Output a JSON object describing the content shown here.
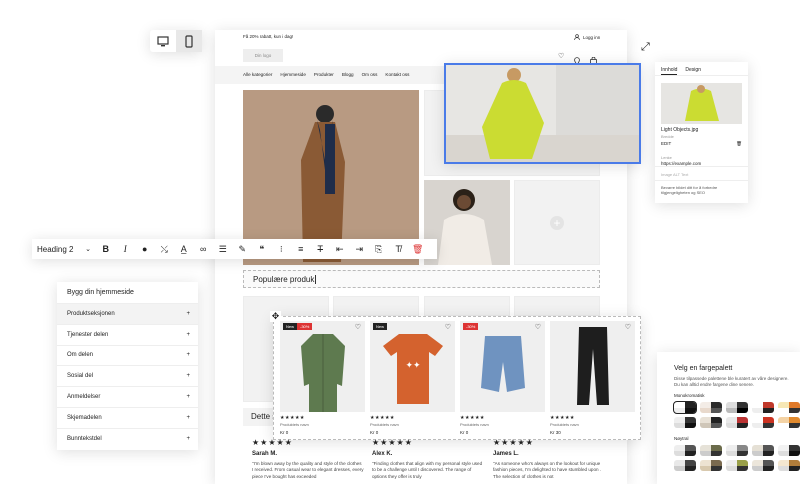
{
  "device_toggle": {
    "desktop": "desktop-icon",
    "mobile": "mobile-icon"
  },
  "site": {
    "promo": "Få 20% rabatt, kun i dag!",
    "login": "Logg inn",
    "logo": "Din logo",
    "nav": [
      "Alle kategorier",
      "Hjemmeside",
      "Produkter",
      "Blogg",
      "Om oss",
      "Kontakt oss"
    ],
    "section_heading": "Populære produk",
    "second_heading": "Dette s"
  },
  "toolbar": {
    "heading_select": "Heading 2"
  },
  "products": [
    {
      "badges": [
        "New",
        "-30%"
      ],
      "stars": "★★★★★",
      "name": "Produktets navn",
      "price": "Kr 0"
    },
    {
      "badges": [
        "New"
      ],
      "stars": "★★★★★",
      "name": "Produktets navn",
      "price": "Kr 0"
    },
    {
      "badges": [
        "-30%"
      ],
      "stars": "★★★★★",
      "name": "Produktets navn",
      "price": "Kr 0"
    },
    {
      "badges": [],
      "stars": "★★★★★",
      "name": "Produktets navn",
      "price": "Kr 30"
    }
  ],
  "reviews": [
    {
      "stars": "★★★★★",
      "name": "Sarah M.",
      "text": "\"I'm blown away by the quality and style of the clothes I received. From casual wear to elegant dresses, every piece I've bought has exceeded"
    },
    {
      "stars": "★★★★★",
      "name": "Alex K.",
      "text": "\"Finding clothes that align with my personal style used to be a challenge until I discovered. The range of options they offer is truly"
    },
    {
      "stars": "★★★★★",
      "name": "James L.",
      "text": "\"As someone who's always on the lookout for unique fashion pieces, I'm delighted to have stumbled upon . The selection of clothes is not"
    }
  ],
  "build_panel": {
    "title": "Bygg din hjemmeside",
    "items": [
      "Produktseksjonen",
      "Tjenester delen",
      "Om delen",
      "Sosial del",
      "Anmeldelser",
      "Skjemadelen",
      "Bunntekstdel"
    ]
  },
  "inspector": {
    "tabs": [
      "Innhold",
      "Design"
    ],
    "file": "Light Objects.jpg",
    "file_sub": "Bredde",
    "edit": "EDIT",
    "link_label": "Lenke",
    "link": "https://example.com",
    "alt": "Image ALT Text",
    "note": "Bevarre bildet ditt for å forbedre tilgjengeligheten og SEO"
  },
  "palette": {
    "title": "Velg en fargepalett",
    "desc": "Disse tilpassede palettene ble kuratert av våre designere. Du kan alltid endre fargene dine senere.",
    "group1": "Monokromatisk",
    "group2": "Nøytral",
    "mono": [
      [
        "#fff",
        "#222",
        "#eee",
        "#111"
      ],
      [
        "#f3ece6",
        "#2b2b2b",
        "#e8d9cc",
        "#555"
      ],
      [
        "#ddd",
        "#333",
        "#bbb",
        "#000"
      ],
      [
        "#fff",
        "#c0392b",
        "#eee",
        "#222"
      ],
      [
        "#f6e7b5",
        "#e07a2a",
        "#fff",
        "#333"
      ]
    ],
    "mono2": [
      [
        "#eee",
        "#333",
        "#ddd",
        "#111"
      ],
      [
        "#e8e1d6",
        "#222",
        "#cfc6b8",
        "#555"
      ],
      [
        "#e9e9e9",
        "#b33",
        "#ddd",
        "#222"
      ],
      [
        "#fff",
        "#c32",
        "#eee",
        "#333"
      ],
      [
        "#f4d3a5",
        "#e08a2e",
        "#fff",
        "#333"
      ]
    ],
    "neutral": [
      [
        "#eee",
        "#555",
        "#ddd",
        "#222"
      ],
      [
        "#e6e2d8",
        "#6b6b4a",
        "#ccc",
        "#333"
      ],
      [
        "#eee",
        "#888",
        "#ddd",
        "#333"
      ],
      [
        "#e5e0d5",
        "#555",
        "#ccc",
        "#222"
      ],
      [
        "#f2f2f2",
        "#333",
        "#ddd",
        "#111"
      ]
    ],
    "neutral2": [
      [
        "#e8e8e8",
        "#444",
        "#ccc",
        "#222"
      ],
      [
        "#ede3d2",
        "#7a6a4f",
        "#d8c9ae",
        "#333"
      ],
      [
        "#eee",
        "#9aa04a",
        "#ddd",
        "#333"
      ],
      [
        "#ece6db",
        "#555",
        "#ccc",
        "#222"
      ],
      [
        "#f4e7d0",
        "#b07d3b",
        "#ddd",
        "#222"
      ]
    ]
  }
}
